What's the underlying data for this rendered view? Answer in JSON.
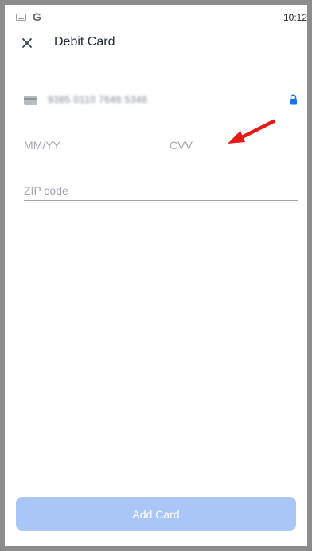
{
  "status_bar": {
    "time": "10:12",
    "icons": [
      "keyboard-icon",
      "google-icon"
    ],
    "google_glyph": "G"
  },
  "header": {
    "title": "Debit Card",
    "close_icon": "close-icon"
  },
  "form": {
    "card_number": {
      "value": "9385 0110 7646 5346",
      "icon": "credit-card-icon",
      "lock_icon": "lock-icon",
      "lock_color": "#1a73e8"
    },
    "expiry": {
      "placeholder": "MM/YY",
      "value": ""
    },
    "cvv": {
      "placeholder": "CVV",
      "value": ""
    },
    "zip": {
      "placeholder": "ZIP code",
      "value": ""
    }
  },
  "annotation": {
    "arrow_color": "#e41b17",
    "target": "cvv"
  },
  "footer": {
    "add_card_label": "Add Card",
    "button_color": "#a9c6f7"
  }
}
